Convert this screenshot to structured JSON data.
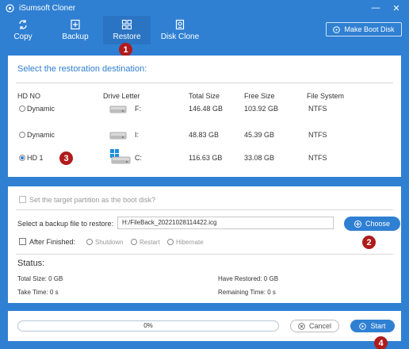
{
  "window": {
    "title": "iSumsoft Cloner",
    "controls": [
      "minimize-icon",
      "close-icon"
    ]
  },
  "toolbar": {
    "items": [
      {
        "label": "Copy",
        "icon": "copy-icon"
      },
      {
        "label": "Backup",
        "icon": "backup-icon"
      },
      {
        "label": "Restore",
        "icon": "restore-icon",
        "active": true
      },
      {
        "label": "Disk Clone",
        "icon": "disk-clone-icon"
      }
    ],
    "make_boot_disk": "Make Boot Disk"
  },
  "destination": {
    "title": "Select the restoration destination:",
    "columns": [
      "HD NO",
      "Drive Letter",
      "Total Size",
      "Free Size",
      "File System"
    ],
    "rows": [
      {
        "hd": "Dynamic",
        "letter": "F:",
        "total": "146.48 GB",
        "free": "103.92 GB",
        "fs": "NTFS",
        "selected": false,
        "icon": "hard-drive-icon"
      },
      {
        "hd": "Dynamic",
        "letter": "I:",
        "total": "48.83 GB",
        "free": "45.39 GB",
        "fs": "NTFS",
        "selected": false,
        "icon": "hard-drive-icon"
      },
      {
        "hd": "HD 1",
        "letter": "C:",
        "total": "116.63 GB",
        "free": "33.08 GB",
        "fs": "NTFS",
        "selected": true,
        "icon": "windows-drive-icon"
      }
    ]
  },
  "options": {
    "boot_disk_label": "Set the target partition as the boot disk?",
    "select_backup_label": "Select a backup file to restore:",
    "backup_path": "H:/FileBack_20221028114422.icg",
    "choose_label": "Choose",
    "after_finished_label": "After Finished:",
    "after_options": [
      "Shutdown",
      "Restart",
      "Hibernate"
    ]
  },
  "status": {
    "title": "Status:",
    "total_size": "Total Size: 0 GB",
    "have_restored": "Have Restored: 0 GB",
    "take_time": "Take Time: 0 s",
    "remaining_time": "Remaining Time: 0 s"
  },
  "progress": {
    "text": "0%",
    "value": 0
  },
  "actions": {
    "cancel": "Cancel",
    "start": "Start"
  },
  "annotations": [
    "1",
    "2",
    "3",
    "4"
  ],
  "colors": {
    "accent": "#2f80d3",
    "badge": "#b01c1c",
    "title_text": "#2f7fcf"
  }
}
